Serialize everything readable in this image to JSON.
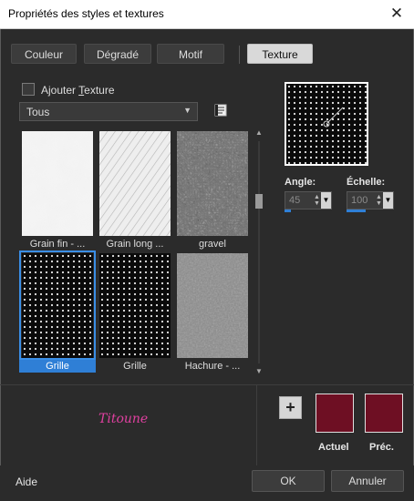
{
  "window": {
    "title": "Propriétés des styles et textures",
    "close_glyph": "✕"
  },
  "tabs": [
    {
      "label": "Couleur",
      "active": false
    },
    {
      "label": "Dégradé",
      "active": false
    },
    {
      "label": "Motif",
      "active": false
    },
    {
      "label": "Texture",
      "active": true
    }
  ],
  "add_texture": {
    "prefix": "Ajouter ",
    "underlined": "T",
    "rest": "exture",
    "checked": false
  },
  "category_dropdown": {
    "value": "Tous"
  },
  "textures": [
    {
      "caption": "Grain fin - ...",
      "kind": "grain-fine",
      "selected": false
    },
    {
      "caption": "Grain long ...",
      "kind": "grain-long",
      "selected": false
    },
    {
      "caption": "gravel",
      "kind": "gravel",
      "selected": false
    },
    {
      "caption": "Grille",
      "kind": "dots",
      "selected": true
    },
    {
      "caption": "Grille",
      "kind": "dots",
      "selected": false
    },
    {
      "caption": "Hachure - ...",
      "kind": "hatch",
      "selected": false
    }
  ],
  "angle": {
    "label": "Angle:",
    "value": "45",
    "fill_percent": 12.5
  },
  "scale": {
    "label": "Échelle:",
    "value": "100",
    "fill_percent": 40
  },
  "signature": {
    "text": "Titoune"
  },
  "colors": {
    "current": {
      "label": "Actuel",
      "color": "#6e0f23"
    },
    "previous": {
      "label": "Préc.",
      "color": "#6e0f23"
    },
    "accent": "#2f7fd6"
  },
  "footer": {
    "help": "Aide",
    "ok": "OK",
    "cancel": "Annuler"
  }
}
